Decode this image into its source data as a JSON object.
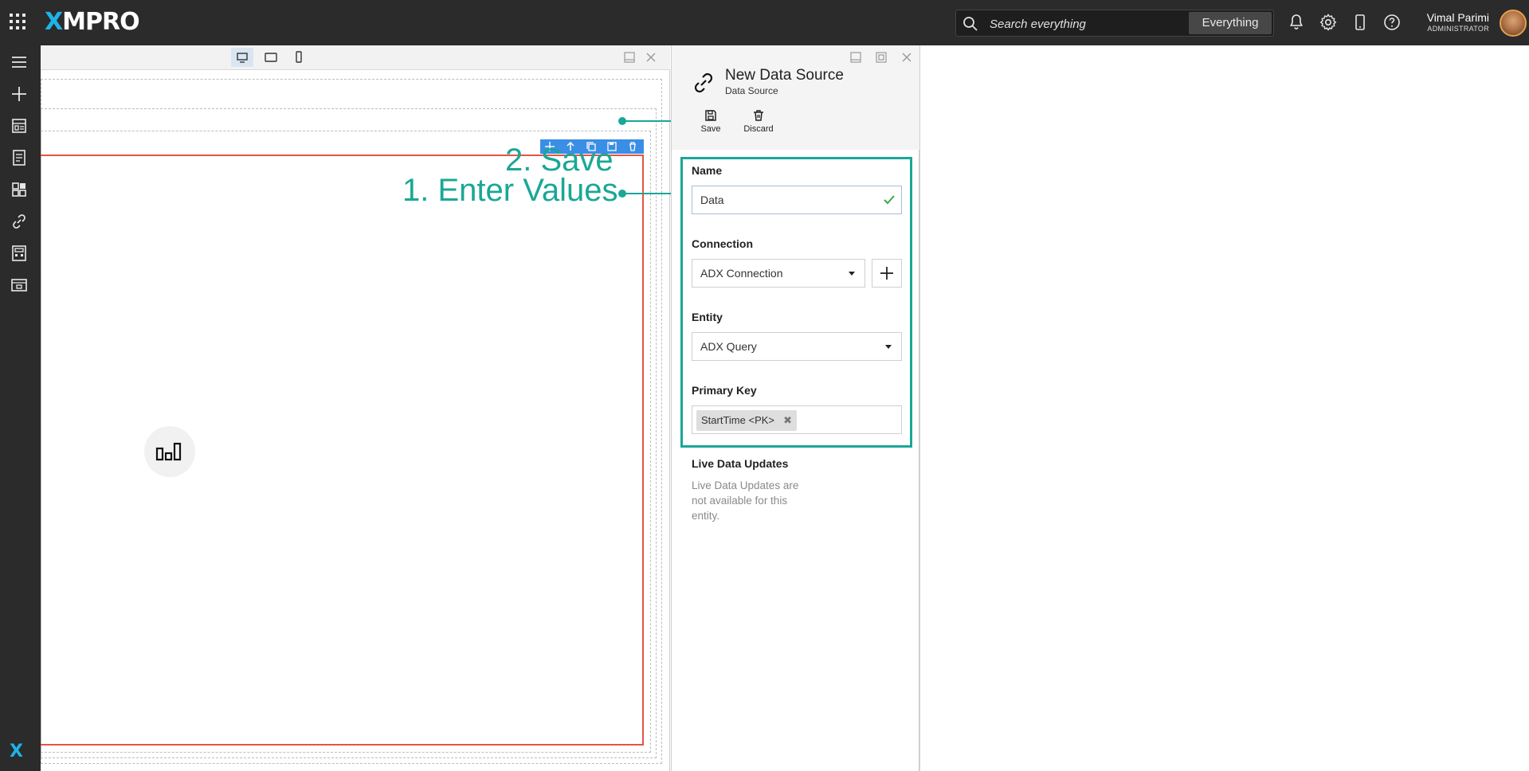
{
  "app": {
    "logo": "XMPRO"
  },
  "search": {
    "placeholder": "Search everything",
    "scope": "Everything"
  },
  "user": {
    "name": "Vimal Parimi",
    "role": "ADMINISTRATOR"
  },
  "topbar_icons": [
    "bell-icon",
    "gear-icon",
    "mobile-icon",
    "help-icon"
  ],
  "nav": {
    "items": [
      "menu-icon",
      "plus-icon",
      "page-layout-icon",
      "recipe-icon",
      "widget-icon",
      "link-icon",
      "calculator-icon",
      "template-icon"
    ],
    "bottom_logo": "X"
  },
  "canvas": {
    "devices": [
      "desktop-icon",
      "tablet-icon",
      "phone-icon"
    ],
    "active_device": "desktop"
  },
  "annotations": {
    "save": "2. Save",
    "enter_values": "1. Enter Values"
  },
  "panel": {
    "title": "New Data Source",
    "subtitle": "Data Source",
    "save_label": "Save",
    "discard_label": "Discard",
    "name_label": "Name",
    "name_value": "Data",
    "connection_label": "Connection",
    "connection_value": "ADX Connection",
    "entity_label": "Entity",
    "entity_value": "ADX Query",
    "primary_key_label": "Primary Key",
    "primary_key_tag": "StartTime <PK>",
    "live_updates_label": "Live Data Updates",
    "live_updates_text": "Live Data Updates are not available for this entity."
  },
  "colors": {
    "topbar": "#2b2b2b",
    "accent_annotation": "#1aa796",
    "selection_frame": "#e25545",
    "element_toolbar": "#3a8ee6",
    "logo_x": "#1fb3e8"
  }
}
